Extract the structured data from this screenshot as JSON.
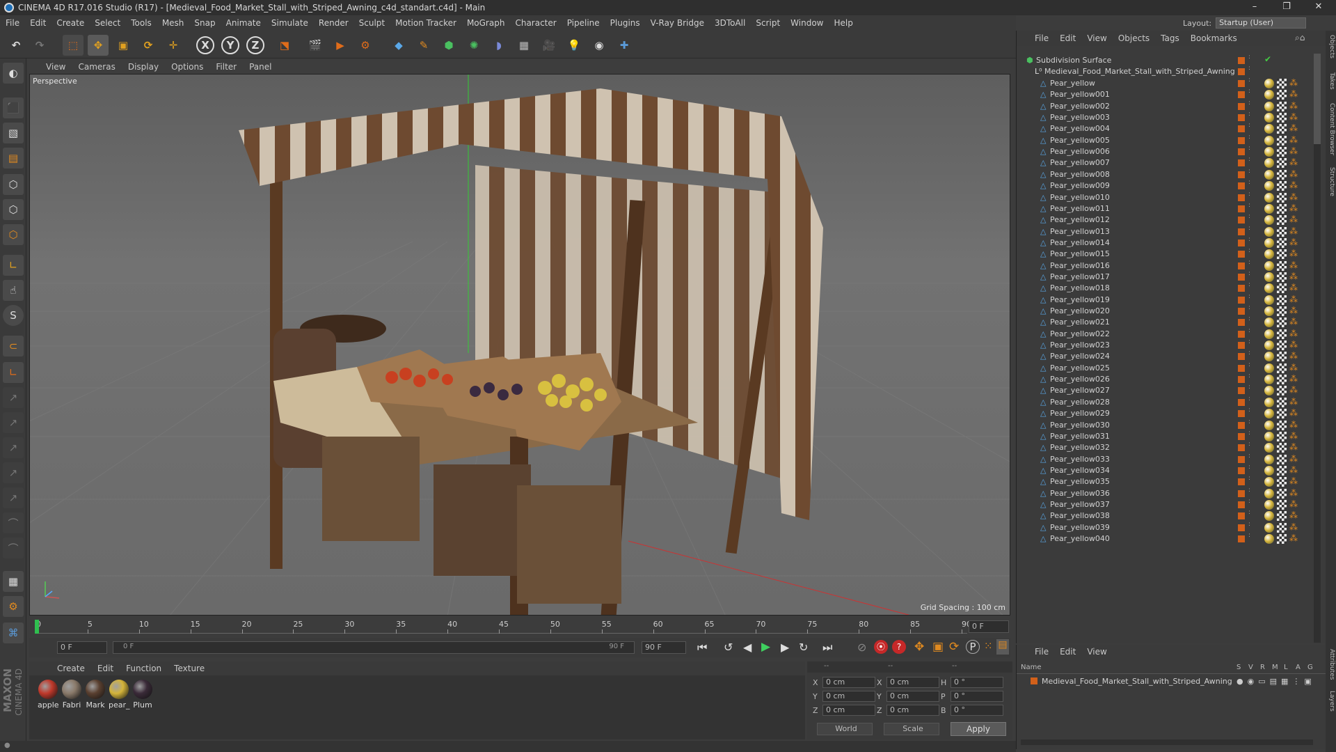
{
  "window": {
    "title": "CINEMA 4D R17.016 Studio (R17) - [Medieval_Food_Market_Stall_with_Striped_Awning_c4d_standart.c4d] - Main",
    "min": "–",
    "max": "❐",
    "close": "✕"
  },
  "menu": [
    "File",
    "Edit",
    "Create",
    "Select",
    "Tools",
    "Mesh",
    "Snap",
    "Animate",
    "Simulate",
    "Render",
    "Sculpt",
    "Motion Tracker",
    "MoGraph",
    "Character",
    "Pipeline",
    "Plugins",
    "V-Ray Bridge",
    "3DToAll",
    "Script",
    "Window",
    "Help"
  ],
  "layout": {
    "label": "Layout:",
    "value": "Startup (User)"
  },
  "toolbar": {
    "x_label": "X",
    "y_label": "Y",
    "z_label": "Z"
  },
  "viewport": {
    "menu": [
      "View",
      "Cameras",
      "Display",
      "Options",
      "Filter",
      "Panel"
    ],
    "camera_label": "Perspective",
    "grid_spacing": "Grid Spacing : 100 cm"
  },
  "timeline": {
    "ticks": [
      "0",
      "5",
      "10",
      "15",
      "20",
      "25",
      "30",
      "35",
      "40",
      "45",
      "50",
      "55",
      "60",
      "65",
      "70",
      "75",
      "80",
      "85",
      "90"
    ],
    "current_frame": "0 F"
  },
  "transport": {
    "start": "0 F",
    "range_start": "0 F",
    "range_end": "90 F",
    "end": "90 F"
  },
  "materials": {
    "menu": [
      "Create",
      "Edit",
      "Function",
      "Texture"
    ],
    "items": [
      {
        "label": "apple",
        "color": "#c0392b"
      },
      {
        "label": "Fabri",
        "color": "#8a7a6a"
      },
      {
        "label": "Mark",
        "color": "#5a4030"
      },
      {
        "label": "pear_",
        "color": "#d4b43a"
      },
      {
        "label": "Plum",
        "color": "#3a2a38"
      }
    ]
  },
  "coords": {
    "header": [
      "--",
      "--",
      "--"
    ],
    "rows": [
      {
        "a": "X",
        "av": "0 cm",
        "b": "X",
        "bv": "0 cm",
        "c": "H",
        "cv": "0 °"
      },
      {
        "a": "Y",
        "av": "0 cm",
        "b": "Y",
        "bv": "0 cm",
        "c": "P",
        "cv": "0 °"
      },
      {
        "a": "Z",
        "av": "0 cm",
        "b": "Z",
        "bv": "0 cm",
        "c": "B",
        "cv": "0 °"
      }
    ],
    "world": "World",
    "scale": "Scale",
    "apply": "Apply"
  },
  "objects": {
    "menu": [
      "File",
      "Edit",
      "View",
      "Objects",
      "Tags",
      "Bookmarks"
    ],
    "root": "Subdivision Surface",
    "group": "Medieval_Food_Market_Stall_with_Striped_Awning",
    "items": [
      "Pear_yellow",
      "Pear_yellow001",
      "Pear_yellow002",
      "Pear_yellow003",
      "Pear_yellow004",
      "Pear_yellow005",
      "Pear_yellow006",
      "Pear_yellow007",
      "Pear_yellow008",
      "Pear_yellow009",
      "Pear_yellow010",
      "Pear_yellow011",
      "Pear_yellow012",
      "Pear_yellow013",
      "Pear_yellow014",
      "Pear_yellow015",
      "Pear_yellow016",
      "Pear_yellow017",
      "Pear_yellow018",
      "Pear_yellow019",
      "Pear_yellow020",
      "Pear_yellow021",
      "Pear_yellow022",
      "Pear_yellow023",
      "Pear_yellow024",
      "Pear_yellow025",
      "Pear_yellow026",
      "Pear_yellow027",
      "Pear_yellow028",
      "Pear_yellow029",
      "Pear_yellow030",
      "Pear_yellow031",
      "Pear_yellow032",
      "Pear_yellow033",
      "Pear_yellow034",
      "Pear_yellow035",
      "Pear_yellow036",
      "Pear_yellow037",
      "Pear_yellow038",
      "Pear_yellow039",
      "Pear_yellow040"
    ]
  },
  "layers": {
    "menu": [
      "File",
      "Edit",
      "View"
    ],
    "columns": [
      "Name",
      "S",
      "V",
      "R",
      "M",
      "L",
      "A",
      "G"
    ],
    "row": "Medieval_Food_Market_Stall_with_Striped_Awning"
  },
  "sidetabs": [
    "Objects",
    "Takes",
    "Content Browser",
    "Structure",
    "Attributes",
    "Layers"
  ],
  "brand": {
    "line1": "MAXON",
    "line2": "CINEMA 4D"
  },
  "colors": {
    "accent": "#e06c1a",
    "selection": "#4a7bc0",
    "tag_orange": "#d2601a"
  }
}
